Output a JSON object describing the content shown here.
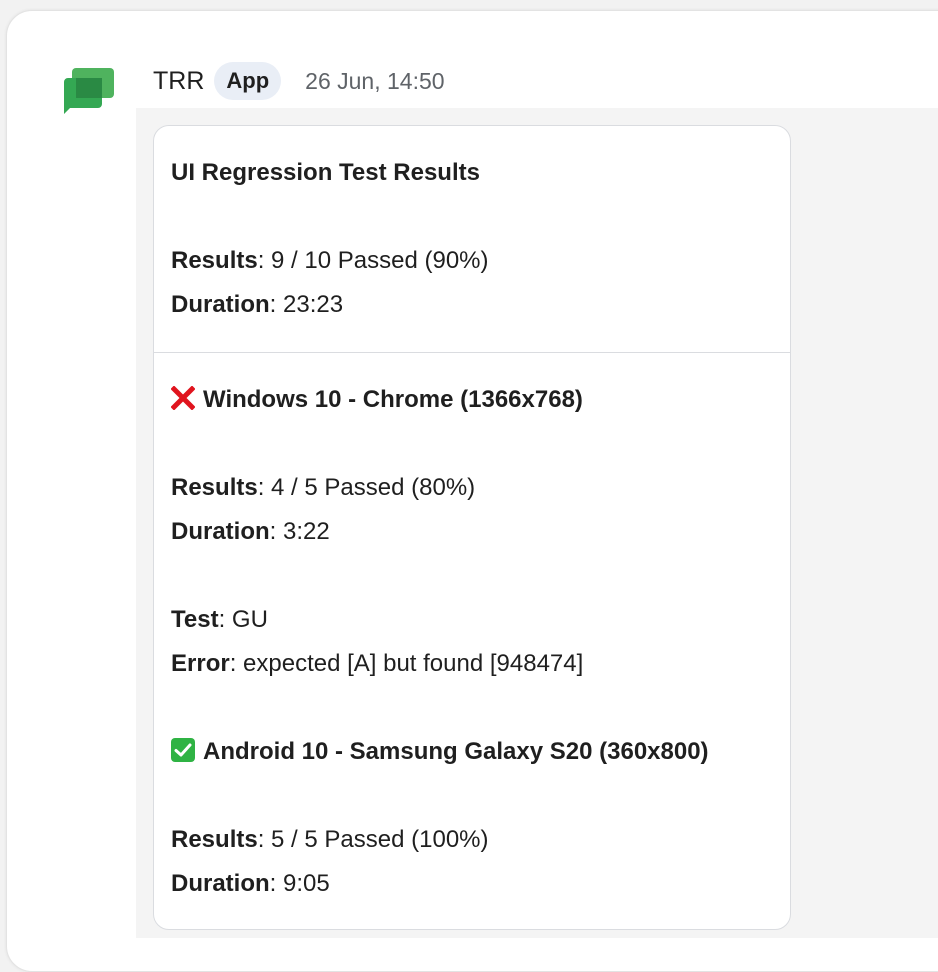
{
  "message": {
    "sender": "TRR",
    "badge": "App",
    "timestamp": "26 Jun, 14:50"
  },
  "card": {
    "title": "UI Regression Test Results",
    "summary": {
      "results_label": "Results",
      "results_value": ": 9 / 10 Passed (90%)",
      "duration_label": "Duration",
      "duration_value": ": 23:23"
    },
    "platforms": [
      {
        "status_icon": "cross-mark-icon",
        "name": "Windows 10 - Chrome (1366x768)",
        "results_label": "Results",
        "results_value": ": 4 / 5 Passed (80%)",
        "duration_label": "Duration",
        "duration_value": ": 3:22",
        "test_label": "Test",
        "test_value": ": GU",
        "error_label": "Error",
        "error_value": ": expected [A] but found [948474]"
      },
      {
        "status_icon": "check-mark-icon",
        "name": "Android 10 - Samsung Galaxy S20 (360x800)",
        "results_label": "Results",
        "results_value": ": 5 / 5 Passed (100%)",
        "duration_label": "Duration",
        "duration_value": ": 9:05"
      }
    ]
  },
  "colors": {
    "app_icon_green": "#34a853",
    "fail_red": "#e0141e",
    "pass_green": "#2fb344",
    "badge_bg": "#e9eef6"
  }
}
